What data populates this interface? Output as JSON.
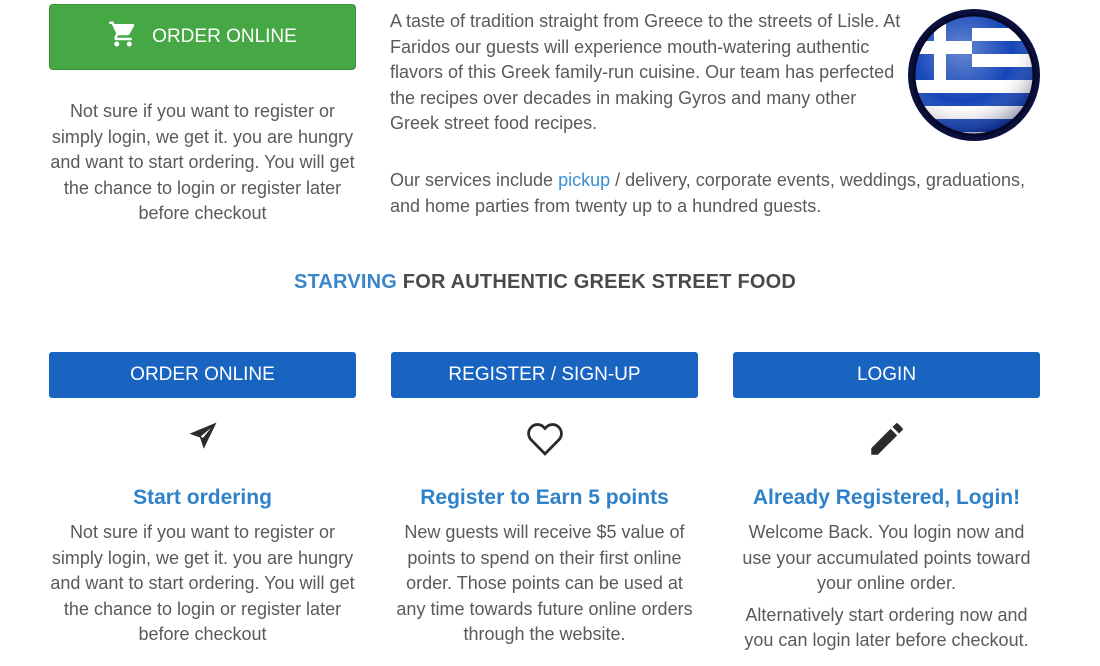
{
  "top": {
    "order_button_label": "ORDER ONLINE",
    "cart_icon": "shopping-cart-icon",
    "intro_text": "Not sure if you want to register or simply login, we get it. you are hungry and want to start ordering. You will get the chance to login or register later before checkout",
    "about_text": "A taste of tradition straight  from Greece to the streets of Lisle. At Faridos our guests will experience mouth-watering authentic flavors of this Greek family-run cuisine. Our team has perfected the recipes over decades in making Gyros and many other Greek street food recipes.",
    "services_prefix": "Our services include ",
    "services_link": "pickup",
    "services_suffix": " / delivery, corporate events, weddings, graduations, and home parties from twenty up to a hundred guests.",
    "flag_icon": "greek-flag-icon"
  },
  "headline": {
    "highlight": "STARVING",
    "rest": " FOR AUTHENTIC GREEK STREET FOOD"
  },
  "columns": [
    {
      "button_label": "ORDER ONLINE",
      "icon": "paper-plane-icon",
      "title": "Start ordering",
      "text": "Not sure if you want to register or simply login, we get it. you are hungry and want to start ordering. You will get the chance to login or register later before checkout"
    },
    {
      "button_label": "REGISTER / SIGN-UP",
      "icon": "heart-icon",
      "title": "Register to Earn 5 points",
      "text": "New guests will receive $5 value of points to spend on their first online order. Those points can be used at any time towards future online orders through the website."
    },
    {
      "button_label": "LOGIN",
      "icon": "pencil-icon",
      "title": "Already Registered, Login!",
      "text": "Welcome Back. You login now and use your accumulated points toward your online order.",
      "text2": "Alternatively start ordering now and you can login later before checkout."
    }
  ],
  "colors": {
    "green_button": "#45a845",
    "blue_button": "#1864c0",
    "accent_blue": "#2f82c9"
  }
}
